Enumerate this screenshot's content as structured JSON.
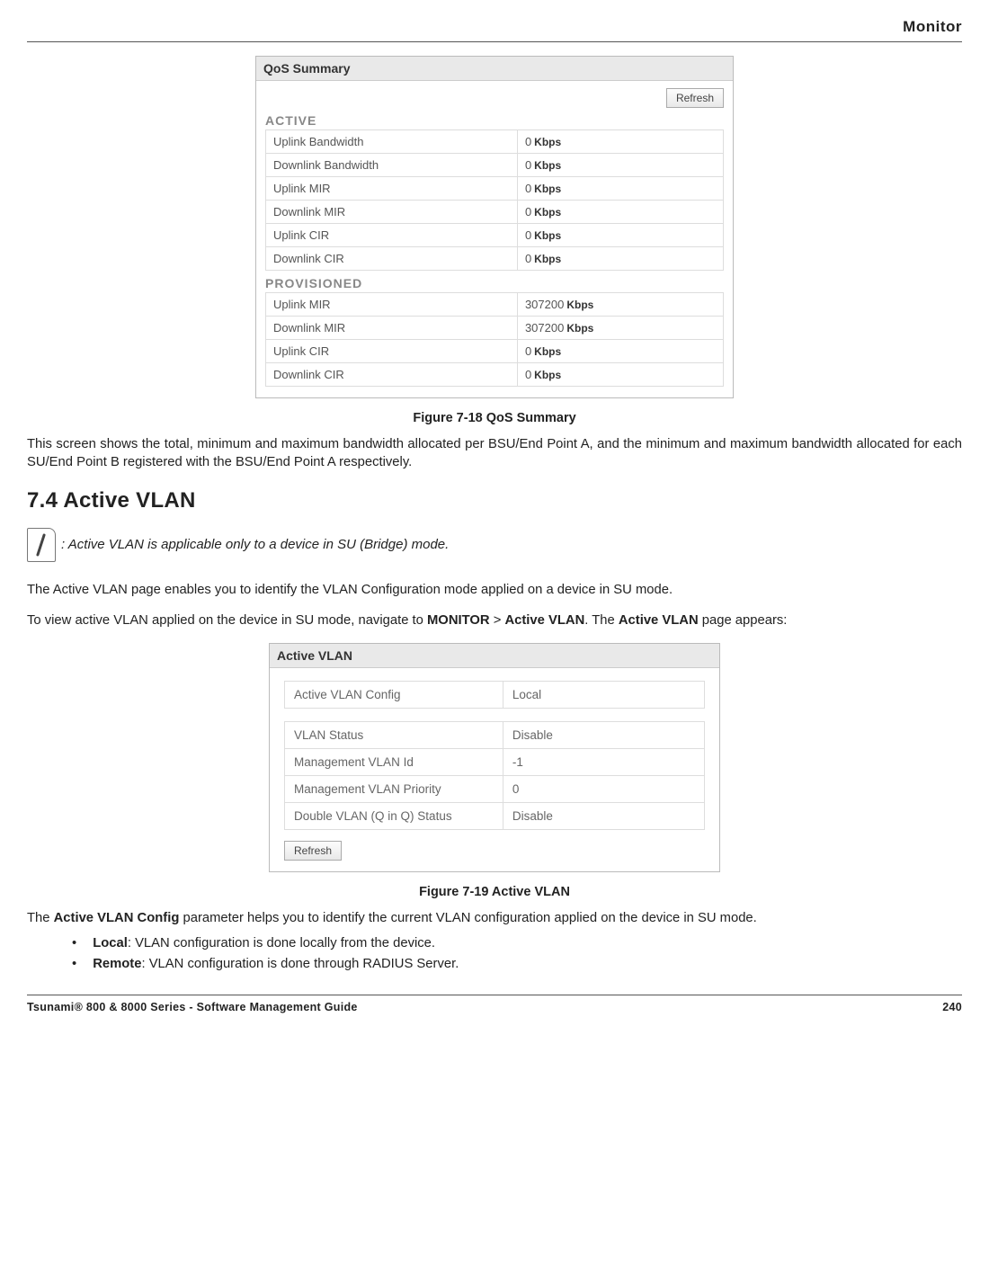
{
  "header": {
    "title": "Monitor"
  },
  "qos": {
    "panel_title": "QoS Summary",
    "refresh_label": "Refresh",
    "active_label": "ACTIVE",
    "provisioned_label": "PROVISIONED",
    "unit": "Kbps",
    "active_rows": [
      {
        "label": "Uplink Bandwidth",
        "value": "0"
      },
      {
        "label": "Downlink Bandwidth",
        "value": "0"
      },
      {
        "label": "Uplink MIR",
        "value": "0"
      },
      {
        "label": "Downlink MIR",
        "value": "0"
      },
      {
        "label": "Uplink CIR",
        "value": "0"
      },
      {
        "label": "Downlink CIR",
        "value": "0"
      }
    ],
    "provisioned_rows": [
      {
        "label": "Uplink MIR",
        "value": "307200"
      },
      {
        "label": "Downlink MIR",
        "value": "307200"
      },
      {
        "label": "Uplink CIR",
        "value": "0"
      },
      {
        "label": "Downlink CIR",
        "value": "0"
      }
    ]
  },
  "captions": {
    "fig1": "Figure 7-18 QoS Summary",
    "fig2": "Figure 7-19 Active VLAN"
  },
  "text": {
    "qos_desc": "This screen shows the total, minimum and maximum bandwidth allocated per BSU/End Point A, and the minimum and maximum bandwidth allocated for each SU/End Point B registered with the BSU/End Point A respectively.",
    "section_heading": "7.4 Active VLAN",
    "note": ": Active VLAN is applicable only to a device in SU (Bridge) mode.",
    "vlan_intro1": "The Active VLAN page enables you to identify the VLAN Configuration mode applied on a device in SU mode.",
    "vlan_intro2_a": "To view active VLAN applied on the device in SU mode, navigate to ",
    "vlan_intro2_b": "MONITOR",
    "vlan_intro2_c": " > ",
    "vlan_intro2_d": "Active VLAN",
    "vlan_intro2_e": ". The ",
    "vlan_intro2_f": "Active VLAN",
    "vlan_intro2_g": " page appears:",
    "post1_a": "The ",
    "post1_b": "Active VLAN Config",
    "post1_c": " parameter helps you to identify the current VLAN configuration applied on the device in SU mode.",
    "bullet1_a": "Local",
    "bullet1_b": ": VLAN configuration is done locally from the device.",
    "bullet2_a": "Remote",
    "bullet2_b": ": VLAN configuration is done through RADIUS Server."
  },
  "vlan": {
    "panel_title": "Active VLAN",
    "refresh_label": "Refresh",
    "row1": [
      {
        "label": "Active VLAN Config",
        "value": "Local"
      }
    ],
    "rows": [
      {
        "label": "VLAN Status",
        "value": "Disable"
      },
      {
        "label": "Management VLAN Id",
        "value": "-1"
      },
      {
        "label": "Management VLAN Priority",
        "value": "0"
      },
      {
        "label": "Double VLAN (Q in Q) Status",
        "value": "Disable"
      }
    ]
  },
  "footer": {
    "left": "Tsunami® 800 & 8000 Series - Software Management Guide",
    "right": "240"
  }
}
